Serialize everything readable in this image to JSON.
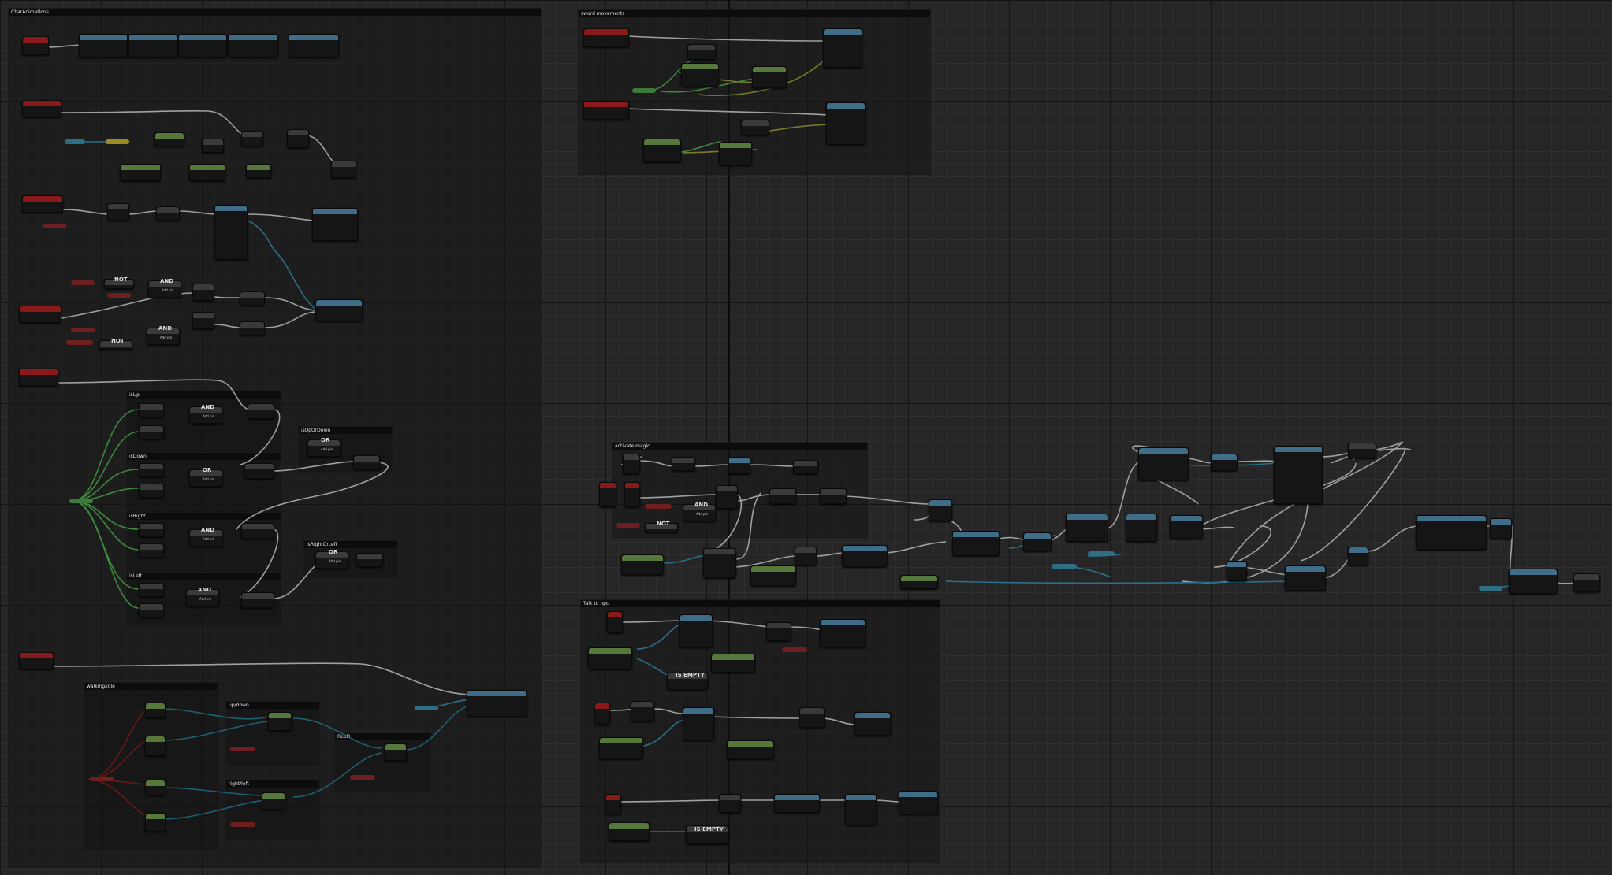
{
  "comments": {
    "char_animations": "CharAnimations",
    "sword_movements": "sword movements",
    "is_up": "isUp",
    "is_down": "isDown",
    "is_right": "isRight",
    "is_left": "isLeft",
    "is_up_or_down": "isUpOrDown",
    "is_right_or_left": "isRightOrLeft",
    "walking_idle": "walking/idle",
    "up_down": "up/down",
    "right_left": "right/left",
    "rlud": "RLUD",
    "activate_magic": "activate magic",
    "talk_to_npc": "Talk to npc"
  },
  "nodes": {
    "not": "NOT",
    "and": "AND",
    "or": "OR",
    "add_pin": "Add pin",
    "is_empty": "IS EMPTY"
  },
  "colors": {
    "event": "#8a1a1a",
    "function": "#3f6c86",
    "pure": "#56783a",
    "exec_wire": "#a8a8a8",
    "bool_wire": "#7a1a1a",
    "object_wire": "#2c6f88",
    "float_wire": "#3d8a3d"
  }
}
